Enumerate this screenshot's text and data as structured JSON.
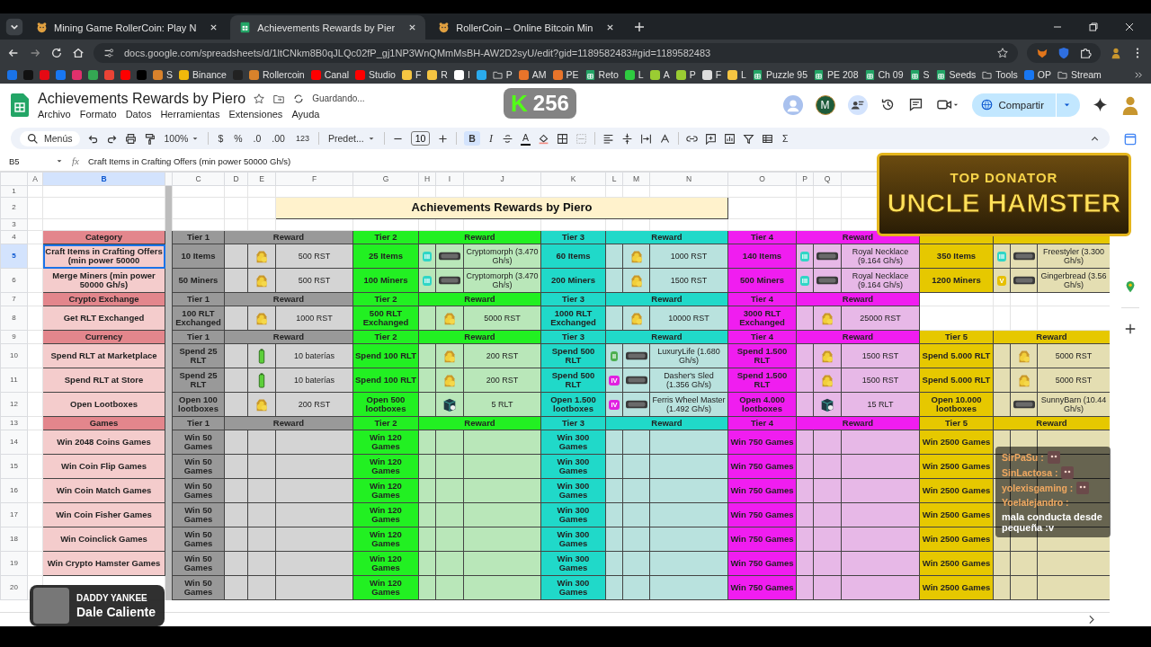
{
  "browser": {
    "tabs": [
      {
        "title": "Mining Game RollerCoin: Play N",
        "kind": "hamster",
        "selected": false
      },
      {
        "title": "Achievements Rewards by Pier",
        "kind": "sheet",
        "selected": true
      },
      {
        "title": "RollerCoin – Online Bitcoin Min",
        "kind": "hamster",
        "selected": false
      }
    ],
    "url": "docs.google.com/spreadsheets/d/1ltCNkm8B0qJLQc02fP_gj1NP3WnQMmMsBH-AW2D2syU/edit?gid=1189582483#gid=1189582483",
    "bookmarks": [
      {
        "kind": "site",
        "color": "#1a73e8"
      },
      {
        "kind": "site",
        "color": "#111111"
      },
      {
        "kind": "site",
        "color": "#e50914"
      },
      {
        "kind": "site",
        "color": "#1877f2"
      },
      {
        "kind": "site",
        "color": "#e1306c"
      },
      {
        "kind": "site",
        "color": "#34a853"
      },
      {
        "kind": "site",
        "color": "#ea4335"
      },
      {
        "kind": "site",
        "color": "#ff0000"
      },
      {
        "kind": "site",
        "color": "#000000"
      },
      {
        "kind": "site",
        "color": "#d9822b",
        "label": "S"
      },
      {
        "kind": "site",
        "color": "#f0b90b",
        "label": "Binance"
      },
      {
        "kind": "site",
        "color": "#222222"
      },
      {
        "kind": "site",
        "color": "#d9822b",
        "label": "Rollercoin"
      },
      {
        "kind": "site",
        "color": "#ff0000",
        "label": "Canal"
      },
      {
        "kind": "site",
        "color": "#ff0000",
        "label": "Studio"
      },
      {
        "kind": "site",
        "color": "#f5c542",
        "label": "F"
      },
      {
        "kind": "site",
        "color": "#f5c542",
        "label": "R"
      },
      {
        "kind": "site",
        "color": "#ffffff",
        "label": "I"
      },
      {
        "kind": "site",
        "color": "#2aabee"
      },
      {
        "kind": "folder",
        "label": "P"
      },
      {
        "kind": "site",
        "color": "#e8742a",
        "label": "AM"
      },
      {
        "kind": "site",
        "color": "#e8742a",
        "label": "PE"
      },
      {
        "kind": "sheet",
        "label": "Reto"
      },
      {
        "kind": "site",
        "color": "#2ecc40",
        "label": "L"
      },
      {
        "kind": "site",
        "color": "#9acd32",
        "label": "A"
      },
      {
        "kind": "site",
        "color": "#9acd32",
        "label": "P"
      },
      {
        "kind": "site",
        "color": "#dddddd",
        "label": "F"
      },
      {
        "kind": "site",
        "color": "#f5c542",
        "label": "L"
      },
      {
        "kind": "sheet",
        "label": "Puzzle 95"
      },
      {
        "kind": "sheet",
        "label": "PE 208"
      },
      {
        "kind": "sheet",
        "label": "Ch 09"
      },
      {
        "kind": "sheet",
        "label": "S"
      },
      {
        "kind": "sheet",
        "label": "Seeds"
      },
      {
        "kind": "folder",
        "label": "Tools"
      },
      {
        "kind": "site",
        "color": "#1877f2",
        "label": "OP"
      },
      {
        "kind": "folder",
        "label": "Stream"
      }
    ]
  },
  "sheet_header": {
    "title": "Achievements Rewards by Piero",
    "status": "Guardando...",
    "menus": [
      "Archivo",
      "Formato",
      "Datos",
      "Herramientas",
      "Extensiones",
      "Ayuda"
    ],
    "collaborator_initial": "M",
    "share": "Compartir"
  },
  "toolbar": {
    "search": "Menús",
    "zoom": "100%",
    "currency": "$",
    "percent": "%",
    "decimals_less": ".0",
    "decimals_more": ".00",
    "number_format": "123",
    "font": "Predet...",
    "font_size": "10",
    "bold": {
      "label": "B",
      "on": true
    },
    "italic": "I",
    "text_color": "A",
    "sum": "Σ"
  },
  "formula_bar": {
    "cell": "B5",
    "fx": "fx",
    "content": "Craft Items in Crafting Offers (min power 50000 Gh/s)"
  },
  "grid": {
    "columns": [
      {
        "label": "A",
        "selected": false
      },
      {
        "label": "B",
        "selected": true
      },
      {
        "label": "C",
        "selected": false
      },
      {
        "label": "D",
        "selected": false
      },
      {
        "label": "E",
        "selected": false
      },
      {
        "label": "F",
        "selected": false
      },
      {
        "label": "G",
        "selected": false
      },
      {
        "label": "H",
        "selected": false
      },
      {
        "label": "I",
        "selected": false
      },
      {
        "label": "J",
        "selected": false
      },
      {
        "label": "K",
        "selected": false
      },
      {
        "label": "L",
        "selected": false
      },
      {
        "label": "M",
        "selected": false
      },
      {
        "label": "N",
        "selected": false
      },
      {
        "label": "O",
        "selected": false
      },
      {
        "label": "P",
        "selected": false
      },
      {
        "label": "Q",
        "selected": false
      }
    ],
    "rows": [
      {
        "kind": "blank",
        "number": "1",
        "selected": false
      },
      {
        "kind": "title",
        "number": "2",
        "selected": false,
        "title": "Achievements Rewards by Piero"
      },
      {
        "kind": "blank",
        "number": "3",
        "selected": false
      },
      {
        "kind": "section",
        "number": "4",
        "selected": false,
        "category": "Category",
        "tiers": [
          {
            "tier": "Tier 1",
            "reward": "Reward",
            "color": "#999999"
          },
          {
            "tier": "Tier 2",
            "reward": "Reward",
            "color": "#22f022"
          },
          {
            "tier": "Tier 3",
            "reward": "Reward",
            "color": "#20d9c9"
          },
          {
            "tier": "Tier 4",
            "reward": "Reward",
            "color": "#f01df0"
          },
          {
            "color": "#e6c800"
          }
        ]
      },
      {
        "kind": "item",
        "number": "5",
        "selected": true,
        "name": "Craft Items in Crafting Offers (min power 50000",
        "tiers": [
          {
            "goal": "10 Items",
            "kind": "coins",
            "reward": "500 RST"
          },
          {
            "goal": "25 Items",
            "badge": {
              "label": "III",
              "color": "#2fd6c6"
            },
            "kind": "miner",
            "reward": "Cryptomorph (3.470 Gh/s)"
          },
          {
            "goal": "60 Items",
            "kind": "coins",
            "reward": "1000 RST"
          },
          {
            "goal": "140 Items",
            "badge": {
              "label": "III",
              "color": "#2fd6c6"
            },
            "kind": "miner",
            "reward": "Royal Necklace (9.164 Gh/s)"
          },
          {
            "goal": "350 Items",
            "badge": {
              "label": "III",
              "color": "#2fd6c6"
            },
            "kind": "miner",
            "reward": "Freestyler (3.300 Gh/s)"
          }
        ]
      },
      {
        "kind": "item",
        "number": "6",
        "selected": false,
        "name": "Merge Miners (min power 50000 Gh/s)",
        "tiers": [
          {
            "goal": "50 Miners",
            "kind": "coins",
            "reward": "500 RST"
          },
          {
            "goal": "100 Miners",
            "badge": {
              "label": "III",
              "color": "#2fd6c6"
            },
            "kind": "miner",
            "reward": "Cryptomorph (3.470 Gh/s)"
          },
          {
            "goal": "200 Miners",
            "kind": "coins",
            "reward": "1500 RST"
          },
          {
            "goal": "500 Miners",
            "badge": {
              "label": "III",
              "color": "#2fd6c6"
            },
            "kind": "miner",
            "reward": "Royal Necklace (9.164 Gh/s)"
          },
          {
            "goal": "1200 Miners",
            "badge": {
              "label": "V",
              "color": "#e6c000"
            },
            "kind": "miner",
            "reward": "Gingerbread (3.56 Gh/s)"
          }
        ]
      },
      {
        "kind": "section",
        "number": "7",
        "selected": false,
        "category": "Crypto Exchange",
        "tiers": [
          {
            "tier": "Tier 1",
            "reward": "Reward",
            "color": "#999999"
          },
          {
            "tier": "Tier 2",
            "reward": "Reward",
            "color": "#22f022"
          },
          {
            "tier": "Tier 3",
            "reward": "Reward",
            "color": "#20d9c9"
          },
          {
            "tier": "Tier 4",
            "reward": "Reward",
            "color": "#f01df0"
          }
        ]
      },
      {
        "kind": "item",
        "number": "8",
        "selected": false,
        "name": "Get RLT Exchanged",
        "tiers": [
          {
            "goal": "100 RLT Exchanged",
            "kind": "coins",
            "reward": "1000 RST"
          },
          {
            "goal": "500 RLT Exchanged",
            "kind": "coins",
            "reward": "5000 RST"
          },
          {
            "goal": "1000 RLT Exchanged",
            "kind": "coins",
            "reward": "10000 RST"
          },
          {
            "goal": "3000 RLT Exchanged",
            "kind": "coins",
            "reward": "25000 RST"
          }
        ]
      },
      {
        "kind": "section",
        "number": "9",
        "selected": false,
        "category": "Currency",
        "tiers": [
          {
            "tier": "Tier 1",
            "reward": "Reward",
            "color": "#999999"
          },
          {
            "tier": "Tier 2",
            "reward": "Reward",
            "color": "#22f022"
          },
          {
            "tier": "Tier 3",
            "reward": "Reward",
            "color": "#20d9c9"
          },
          {
            "tier": "Tier 4",
            "reward": "Reward",
            "color": "#f01df0"
          },
          {
            "tier": "Tier 5",
            "reward": "Reward",
            "color": "#e6c800"
          }
        ]
      },
      {
        "kind": "item",
        "number": "10",
        "selected": false,
        "name": "Spend RLT at Marketplace",
        "tiers": [
          {
            "goal": "Spend 25 RLT",
            "kind": "battery",
            "reward": "10 baterías"
          },
          {
            "goal": "Spend 100 RLT",
            "kind": "coins",
            "reward": "200 RST"
          },
          {
            "goal": "Spend 500 RLT",
            "badge": {
              "label": "II",
              "color": "#4caf50"
            },
            "kind": "miner",
            "reward": "LuxuryLife (1.680 Gh/s)"
          },
          {
            "goal": "Spend 1.500 RLT",
            "kind": "coins",
            "reward": "1500 RST"
          },
          {
            "goal": "Spend 5.000 RLT",
            "kind": "coins",
            "reward": "5000 RST"
          }
        ]
      },
      {
        "kind": "item",
        "number": "11",
        "selected": false,
        "name": "Spend RLT at Store",
        "tiers": [
          {
            "goal": "Spend 25 RLT",
            "kind": "battery",
            "reward": "10 baterías"
          },
          {
            "goal": "Spend 100 RLT",
            "kind": "coins",
            "reward": "200 RST"
          },
          {
            "goal": "Spend 500 RLT",
            "badge": {
              "label": "IV",
              "color": "#e020e0"
            },
            "kind": "miner",
            "reward": "Dasher's Sled (1.356 Gh/s)"
          },
          {
            "goal": "Spend 1.500 RLT",
            "kind": "coins",
            "reward": "1500 RST"
          },
          {
            "goal": "Spend 5.000 RLT",
            "kind": "coins",
            "reward": "5000 RST"
          }
        ]
      },
      {
        "kind": "item",
        "number": "12",
        "selected": false,
        "name": "Open Lootboxes",
        "tiers": [
          {
            "goal": "Open 100 lootboxes",
            "kind": "coins",
            "reward": "200 RST"
          },
          {
            "goal": "Open 500 lootboxes",
            "kind": "lootbox",
            "reward": "5 RLT"
          },
          {
            "goal": "Open 1.500 lootboxes",
            "badge": {
              "label": "IV",
              "color": "#e020e0"
            },
            "kind": "miner",
            "reward": "Ferris Wheel Master (1.492 Gh/s)"
          },
          {
            "goal": "Open 4.000 lootboxes",
            "kind": "lootbox",
            "reward": "15 RLT"
          },
          {
            "goal": "Open 10.000 lootboxes",
            "kind": "miner",
            "reward": "SunnyBarn (10.44 Gh/s)"
          }
        ]
      },
      {
        "kind": "section",
        "number": "13",
        "selected": false,
        "category": "Games",
        "tiers": [
          {
            "tier": "Tier 1",
            "reward": "Reward",
            "color": "#999999"
          },
          {
            "tier": "Tier 2",
            "reward": "Reward",
            "color": "#22f022"
          },
          {
            "tier": "Tier 3",
            "reward": "Reward",
            "color": "#20d9c9"
          },
          {
            "tier": "Tier 4",
            "reward": "Reward",
            "color": "#f01df0"
          },
          {
            "tier": "Tier 5",
            "reward": "Reward",
            "color": "#e6c800"
          }
        ]
      },
      {
        "kind": "item",
        "number": "14",
        "selected": false,
        "name": "Win 2048 Coins Games",
        "tiers": [
          {
            "goal": "Win 50 Games"
          },
          {
            "goal": "Win 120 Games"
          },
          {
            "goal": "Win 300 Games"
          },
          {
            "goal": "Win 750 Games"
          },
          {
            "goal": "Win 2500 Games"
          }
        ]
      },
      {
        "kind": "item",
        "number": "15",
        "selected": false,
        "name": "Win Coin Flip Games",
        "tiers": [
          {
            "goal": "Win 50 Games"
          },
          {
            "goal": "Win 120 Games"
          },
          {
            "goal": "Win 300 Games"
          },
          {
            "goal": "Win 750 Games"
          },
          {
            "goal": "Win 2500 Games"
          }
        ]
      },
      {
        "kind": "item",
        "number": "16",
        "selected": false,
        "name": "Win Coin Match Games",
        "tiers": [
          {
            "goal": "Win 50 Games"
          },
          {
            "goal": "Win 120 Games"
          },
          {
            "goal": "Win 300 Games"
          },
          {
            "goal": "Win 750 Games"
          },
          {
            "goal": "Win 2500 Games"
          }
        ]
      },
      {
        "kind": "item",
        "number": "17",
        "selected": false,
        "name": "Win Coin Fisher Games",
        "tiers": [
          {
            "goal": "Win 50 Games"
          },
          {
            "goal": "Win 120 Games"
          },
          {
            "goal": "Win 300 Games"
          },
          {
            "goal": "Win 750 Games"
          },
          {
            "goal": "Win 2500 Games"
          }
        ]
      },
      {
        "kind": "item",
        "number": "18",
        "selected": false,
        "name": "Win Coinclick Games",
        "tiers": [
          {
            "goal": "Win 50 Games"
          },
          {
            "goal": "Win 120 Games"
          },
          {
            "goal": "Win 300 Games"
          },
          {
            "goal": "Win 750 Games"
          },
          {
            "goal": "Win 2500 Games"
          }
        ]
      },
      {
        "kind": "item",
        "number": "19",
        "selected": false,
        "name": "Win Crypto Hamster Games",
        "tiers": [
          {
            "goal": "Win 50 Games"
          },
          {
            "goal": "Win 120 Games"
          },
          {
            "goal": "Win 300 Games"
          },
          {
            "goal": "Win 750 Games"
          },
          {
            "goal": "Win 2500 Games"
          }
        ]
      },
      {
        "kind": "item",
        "number": "20",
        "selected": false,
        "tiers": [
          {
            "goal": "Win 50 Games"
          },
          {
            "goal": "Win 120 Games"
          },
          {
            "goal": "Win 300 Games"
          },
          {
            "goal": "Win 750 Games"
          },
          {
            "goal": "Win 2500 Games"
          }
        ]
      }
    ]
  },
  "overlays": {
    "viewer_count": {
      "logo": "K",
      "count": "256"
    },
    "donator": {
      "heading": "TOP DONATOR",
      "name": "UNCLE HAMSTER"
    },
    "chat": [
      {
        "user": "SirPaSu :",
        "emote": true
      },
      {
        "user": "SinLactosa :",
        "emote": true
      },
      {
        "user": "yolexisgaming :",
        "emote": true
      },
      {
        "user": "Yoelalejandro :",
        "emote": false,
        "text": "mala conducta desde pequeña :v"
      }
    ],
    "now_playing": {
      "artist": "DADDY YANKEE",
      "title": "Dale Caliente"
    }
  }
}
